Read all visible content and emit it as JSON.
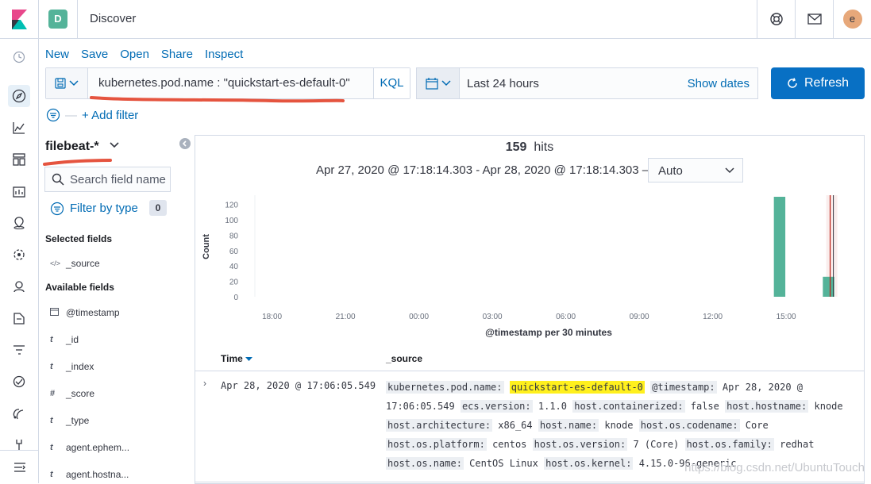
{
  "header": {
    "space_letter": "D",
    "title": "Discover",
    "avatar_letter": "e"
  },
  "menu": {
    "new": "New",
    "save": "Save",
    "open": "Open",
    "share": "Share",
    "inspect": "Inspect"
  },
  "query": {
    "text": "kubernetes.pod.name : \"quickstart-es-default-0\"",
    "language": "KQL"
  },
  "datepicker": {
    "range": "Last 24 hours",
    "show_dates": "Show dates"
  },
  "refresh_label": "Refresh",
  "filter": {
    "add_label": "+ Add filter"
  },
  "sidebar": {
    "index_pattern": "filebeat-*",
    "search_placeholder": "Search field name",
    "filter_by_type": "Filter by type",
    "filter_count": "0",
    "selected_heading": "Selected fields",
    "selected_fields": [
      {
        "type": "</>",
        "name": "_source"
      }
    ],
    "available_heading": "Available fields",
    "available_fields": [
      {
        "type": "cal",
        "name": "@timestamp"
      },
      {
        "type": "t",
        "name": "_id"
      },
      {
        "type": "t",
        "name": "_index"
      },
      {
        "type": "#",
        "name": "_score"
      },
      {
        "type": "t",
        "name": "_type"
      },
      {
        "type": "t",
        "name": "agent.ephem..."
      },
      {
        "type": "t",
        "name": "agent.hostna..."
      }
    ]
  },
  "results": {
    "hits_count": "159",
    "hits_label": "hits",
    "time_range": "Apr 27, 2020 @ 17:18:14.303 - Apr 28, 2020 @ 17:18:14.303 —",
    "interval": "Auto"
  },
  "chart_data": {
    "type": "bar",
    "ylabel": "Count",
    "xlabel": "@timestamp per 30 minutes",
    "y_ticks": [
      "120",
      "100",
      "80",
      "60",
      "40",
      "20",
      "0"
    ],
    "x_ticks": [
      "18:00",
      "21:00",
      "00:00",
      "03:00",
      "06:00",
      "09:00",
      "12:00",
      "15:00"
    ],
    "ylim": [
      0,
      130
    ],
    "bars": [
      {
        "x": "14:30",
        "value": 130
      },
      {
        "x": "16:30",
        "value": 26
      }
    ],
    "bar_color": "#54b399",
    "current_time_marker_color": "#bd271e"
  },
  "table": {
    "time_header": "Time",
    "source_header": "_source",
    "rows": [
      {
        "time": "Apr 28, 2020 @ 17:06:05.549",
        "fields": [
          {
            "k": "kubernetes.pod.name:",
            "v": "quickstart-es-default-0",
            "highlight": true
          },
          {
            "k": "@timestamp:",
            "v": "Apr 28, 2020 @ 17:06:05.549"
          },
          {
            "k": "ecs.version:",
            "v": "1.1.0"
          },
          {
            "k": "host.containerized:",
            "v": "false"
          },
          {
            "k": "host.hostname:",
            "v": "knode"
          },
          {
            "k": "host.architecture:",
            "v": "x86_64"
          },
          {
            "k": "host.name:",
            "v": "knode"
          },
          {
            "k": "host.os.codename:",
            "v": "Core"
          },
          {
            "k": "host.os.platform:",
            "v": "centos"
          },
          {
            "k": "host.os.version:",
            "v": "7 (Core)"
          },
          {
            "k": "host.os.family:",
            "v": "redhat"
          },
          {
            "k": "host.os.name:",
            "v": "CentOS Linux"
          },
          {
            "k": "host.os.kernel:",
            "v": "4.15.0-96-generic"
          }
        ]
      }
    ]
  },
  "watermark": "https://blog.csdn.net/UbuntuTouch"
}
